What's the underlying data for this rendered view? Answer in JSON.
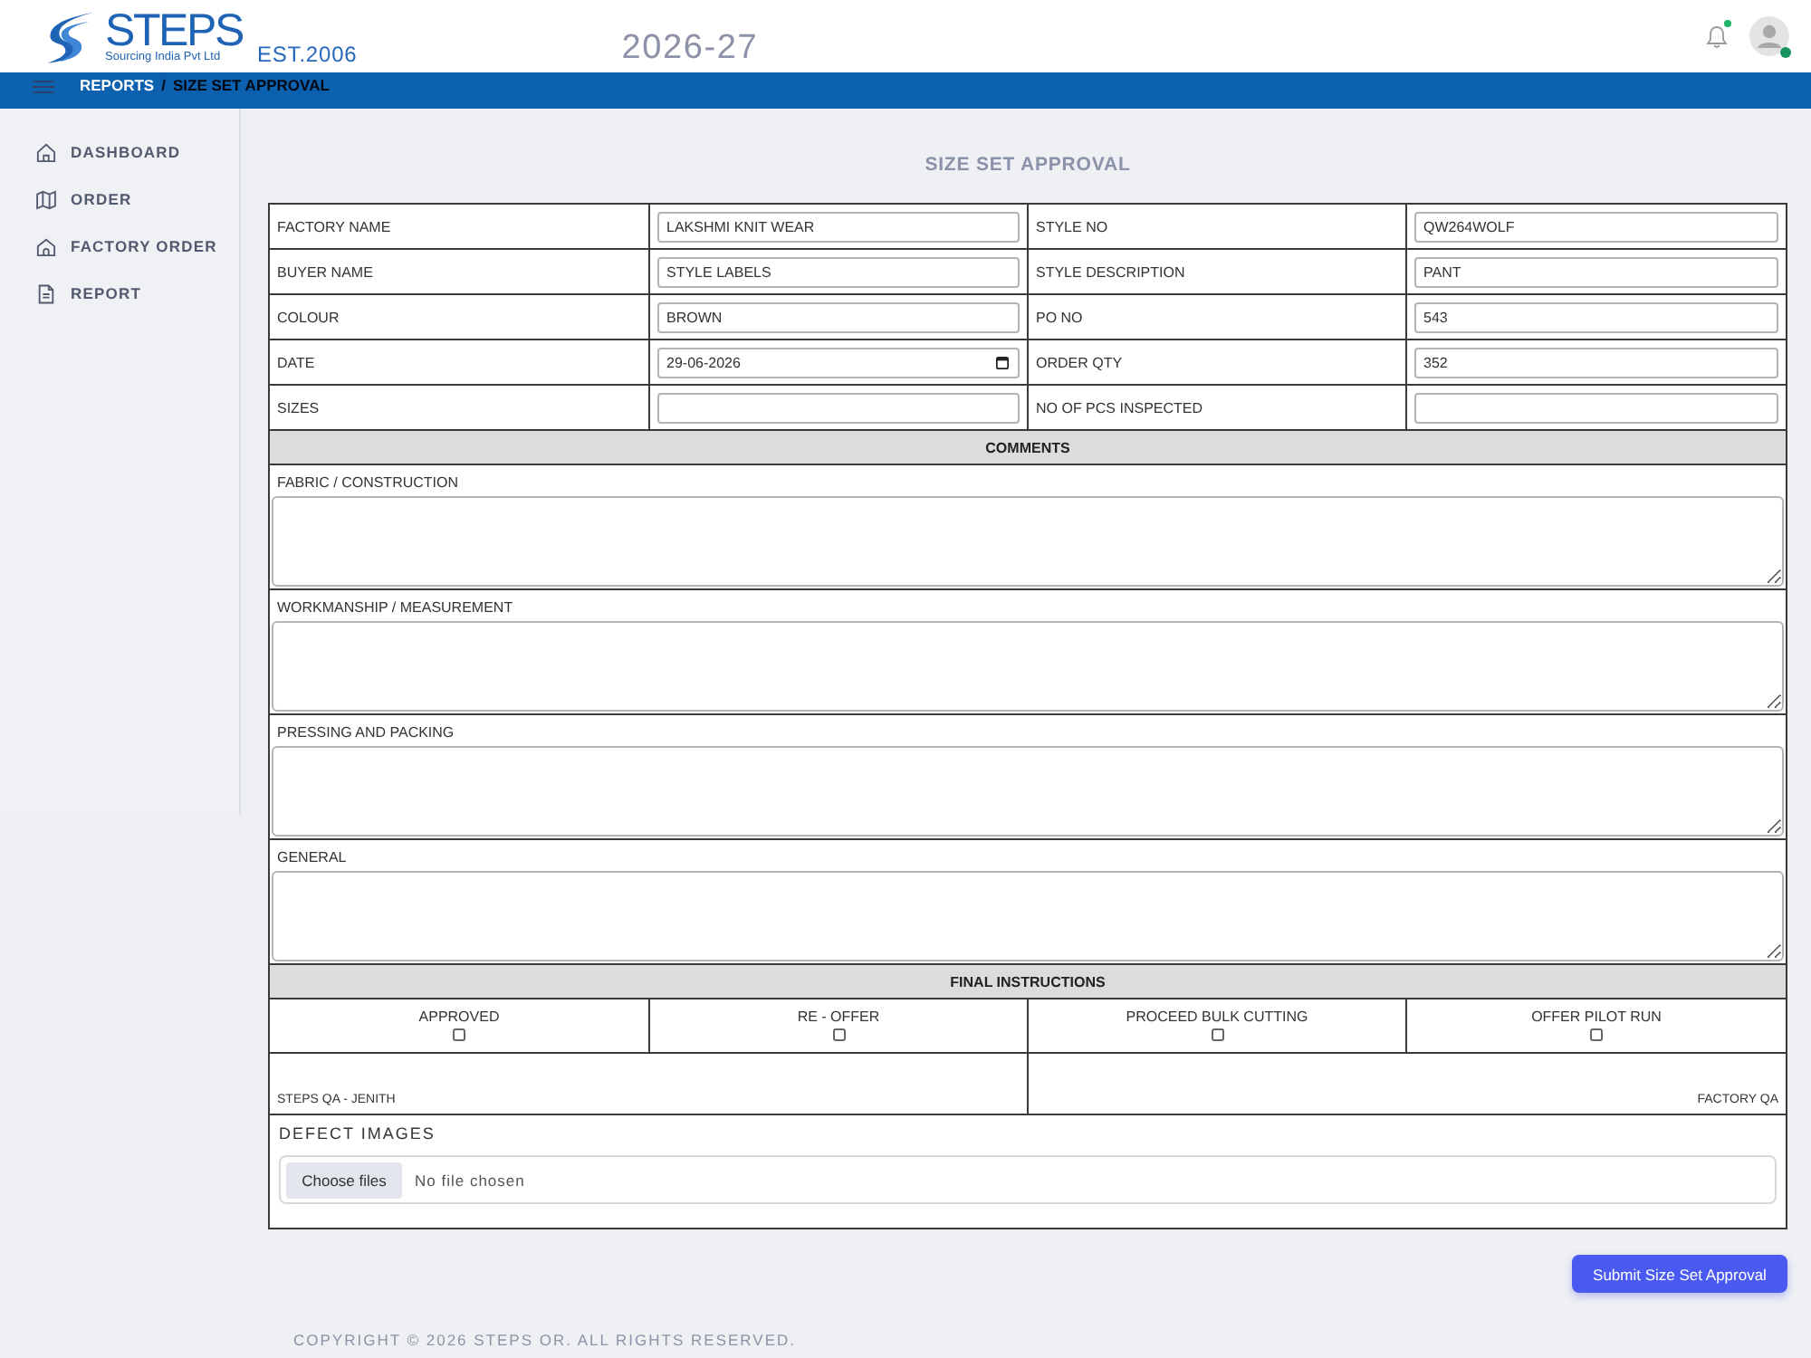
{
  "header": {
    "brand": {
      "name": "STEPS",
      "tagline": "Sourcing India Pvt Ltd"
    },
    "established": "EST.2006",
    "year": "2026-27",
    "notification_dot": true,
    "user_online": true
  },
  "breadcrumb": {
    "separator": "/",
    "items": [
      {
        "label": "REPORTS",
        "current": false
      },
      {
        "label": "SIZE SET APPROVAL",
        "current": true
      }
    ]
  },
  "sidebar": {
    "items": [
      {
        "label": "DASHBOARD",
        "selected": false
      },
      {
        "label": "ORDER",
        "selected": false
      },
      {
        "label": "FACTORY ORDER",
        "selected": false
      },
      {
        "label": "REPORT",
        "selected": false
      }
    ]
  },
  "page_title": "SIZE SET APPROVAL",
  "details": [
    {
      "label": "FACTORY NAME",
      "value": "LAKSHMI KNIT WEAR",
      "kind": "text"
    },
    {
      "label": "STYLE NO",
      "value": "QW264WOLF",
      "kind": "text"
    },
    {
      "label": "BUYER NAME",
      "value": "STYLE LABELS",
      "kind": "text"
    },
    {
      "label": "STYLE DESCRIPTION",
      "value": "PANT",
      "kind": "text"
    },
    {
      "label": "COLOUR",
      "value": "BROWN",
      "kind": "text"
    },
    {
      "label": "PO NO",
      "value": "543",
      "kind": "text"
    },
    {
      "label": "DATE",
      "value": "29-06-2026",
      "kind": "date"
    },
    {
      "label": "ORDER QTY",
      "value": "352",
      "kind": "text"
    },
    {
      "label": "SIZES",
      "kind": "text"
    },
    {
      "label": "NO OF PCS INSPECTED",
      "kind": "text"
    }
  ],
  "comments": {
    "title": "COMMENTS",
    "sections": [
      {
        "label": "FABRIC / CONSTRUCTION"
      },
      {
        "label": "WORKMANSHIP / MEASUREMENT"
      },
      {
        "label": "PRESSING AND PACKING"
      },
      {
        "label": "GENERAL"
      }
    ]
  },
  "final_instructions": {
    "title": "FINAL INSTRUCTIONS",
    "options": [
      {
        "label": "APPROVED",
        "checked": false
      },
      {
        "label": "RE - OFFER",
        "checked": false
      },
      {
        "label": "PROCEED BULK CUTTING",
        "checked": false
      },
      {
        "label": "OFFER PILOT RUN",
        "checked": false
      }
    ],
    "signatures": [
      {
        "label": "STEPS QA - JENITH"
      },
      {
        "label": "FACTORY QA"
      }
    ]
  },
  "defect_images": {
    "label": "DEFECT IMAGES",
    "button": "Choose files",
    "status": "No file chosen"
  },
  "submit_button": "Submit Size Set Approval",
  "footer": "COPYRIGHT © 2026 STEPS OR. ALL RIGHTS RESERVED."
}
